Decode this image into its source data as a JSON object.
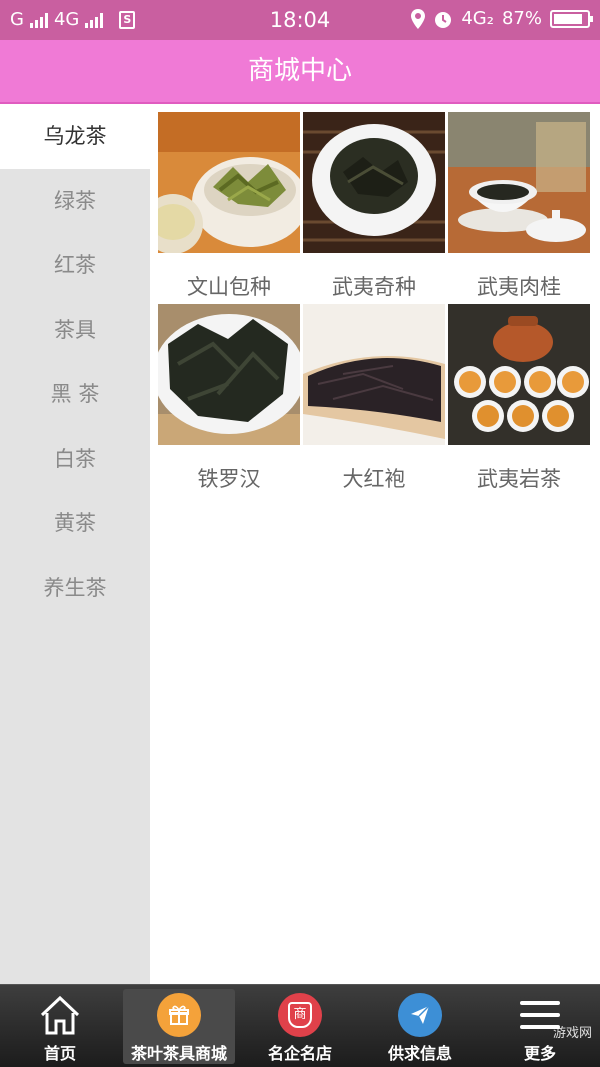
{
  "status_bar": {
    "carrier_1": "G",
    "carrier_2": "4G",
    "time": "18:04",
    "network": "4G₂",
    "battery_percent": "87%",
    "battery_level": 0.87,
    "sim_badge": "S"
  },
  "header": {
    "title": "商城中心"
  },
  "sidebar": {
    "items": [
      {
        "label": "乌龙茶",
        "active": true
      },
      {
        "label": "绿茶"
      },
      {
        "label": "红茶"
      },
      {
        "label": "茶具"
      },
      {
        "label": "黑 茶"
      },
      {
        "label": "白茶"
      },
      {
        "label": "黄茶"
      },
      {
        "label": "养生茶"
      }
    ]
  },
  "products": [
    {
      "name": "文山包种",
      "image": "green-oolong-leaves-in-bowl"
    },
    {
      "name": "武夷奇种",
      "image": "dark-tea-in-white-bowl"
    },
    {
      "name": "武夷肉桂",
      "image": "tea-in-gaiwan-cup"
    },
    {
      "name": "铁罗汉",
      "image": "dark-twisted-leaves-on-plate"
    },
    {
      "name": "大红袍",
      "image": "dark-tea-on-bamboo-scoop"
    },
    {
      "name": "武夷岩茶",
      "image": "teapot-and-tea-cups"
    }
  ],
  "bottom_nav": {
    "items": [
      {
        "label": "首页",
        "icon": "home-icon"
      },
      {
        "label": "茶叶茶具商城",
        "icon": "gift-icon",
        "active": true
      },
      {
        "label": "名企名店",
        "icon": "shop-badge-icon",
        "glyph": "商"
      },
      {
        "label": "供求信息",
        "icon": "paper-plane-icon"
      },
      {
        "label": "更多",
        "icon": "menu-icon"
      }
    ]
  },
  "watermark": "游戏网",
  "colors": {
    "status_bar": "#c95fa0",
    "title_bar": "#f07ad6",
    "sidebar_bg": "#e3e3e3",
    "nav_orange": "#f4a23a",
    "nav_red": "#e0414a",
    "nav_blue": "#3d8fd6"
  }
}
